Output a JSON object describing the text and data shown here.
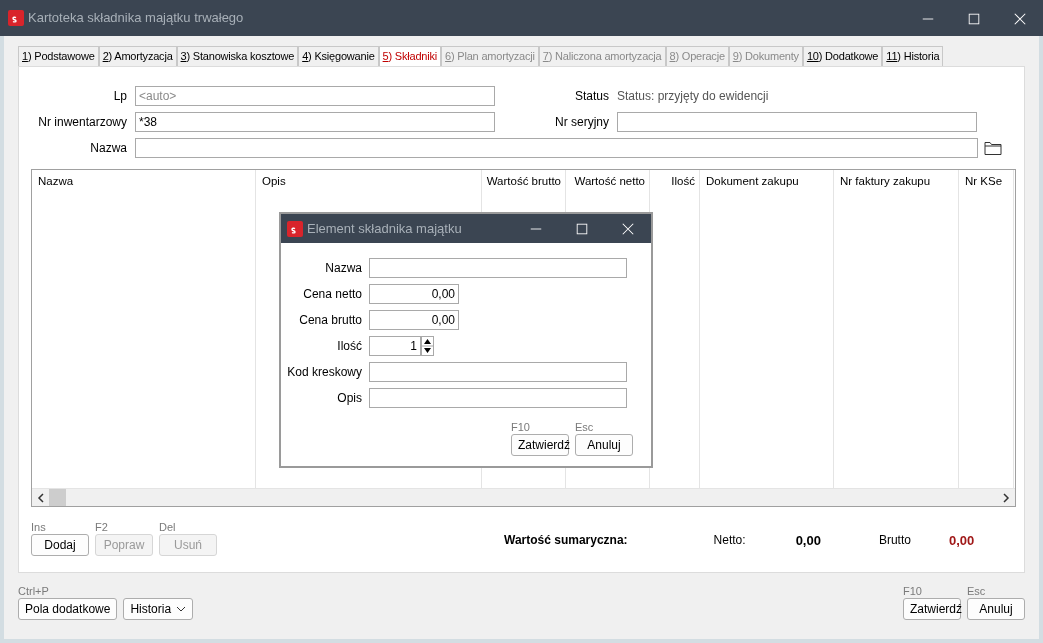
{
  "window": {
    "title": "Kartoteka składnika majątku trwałego"
  },
  "tabs": [
    {
      "key": "1",
      "label": ") Podstawowe",
      "selected": false,
      "disabled": false
    },
    {
      "key": "2",
      "label": ") Amortyzacja",
      "selected": false,
      "disabled": false
    },
    {
      "key": "3",
      "label": ") Stanowiska kosztowe",
      "selected": false,
      "disabled": false
    },
    {
      "key": "4",
      "label": ") Księgowanie",
      "selected": false,
      "disabled": false
    },
    {
      "key": "5",
      "label": ") Składniki",
      "selected": true,
      "disabled": false
    },
    {
      "key": "6",
      "label": ") Plan amortyzacji",
      "selected": false,
      "disabled": true
    },
    {
      "key": "7",
      "label": ") Naliczona amortyzacja",
      "selected": false,
      "disabled": true
    },
    {
      "key": "8",
      "label": ") Operacje",
      "selected": false,
      "disabled": true
    },
    {
      "key": "9",
      "label": ") Dokumenty",
      "selected": false,
      "disabled": true
    },
    {
      "key": "10",
      "label": ") Dodatkowe",
      "selected": false,
      "disabled": false
    },
    {
      "key": "11",
      "label": ") Historia",
      "selected": false,
      "disabled": false
    }
  ],
  "form": {
    "lp": {
      "label": "Lp",
      "placeholder": "<auto>"
    },
    "status": {
      "label": "Status",
      "value": "Status: przyjęty do ewidencji"
    },
    "inventory_no": {
      "label": "Nr inwentarzowy",
      "value": "*38"
    },
    "serial_no": {
      "label": "Nr seryjny"
    },
    "name": {
      "label": "Nazwa"
    }
  },
  "table": {
    "columns": [
      "Nazwa",
      "Opis",
      "Wartość brutto",
      "Wartość netto",
      "Ilość",
      "Dokument zakupu",
      "Nr faktury zakupu",
      "Nr KSe"
    ]
  },
  "grid_buttons": [
    {
      "shortcut": "Ins",
      "label": "Dodaj",
      "disabled": false
    },
    {
      "shortcut": "F2",
      "label": "Popraw",
      "disabled": true
    },
    {
      "shortcut": "Del",
      "label": "Usuń",
      "disabled": true
    }
  ],
  "summary": {
    "label": "Wartość sumaryczna:",
    "net_label": "Netto:",
    "net": "0,00",
    "gross_label": "Brutto",
    "gross": "0,00"
  },
  "footer": {
    "extra_shortcut": "Ctrl+P",
    "extra_button": "Pola dodatkowe",
    "history_select": "Historia",
    "ok_shortcut": "F10",
    "ok": "Zatwierdź",
    "cancel_shortcut": "Esc",
    "cancel": "Anuluj"
  },
  "dialog": {
    "title": "Element składnika majątku",
    "fields": [
      {
        "label": "Nazwa",
        "kind": "text"
      },
      {
        "label": "Cena netto",
        "kind": "number",
        "value": "0,00"
      },
      {
        "label": "Cena brutto",
        "kind": "number",
        "value": "0,00"
      },
      {
        "label": "Ilość",
        "kind": "spin",
        "value": "1"
      },
      {
        "label": "Kod kreskowy",
        "kind": "text"
      },
      {
        "label": "Opis",
        "kind": "text"
      }
    ],
    "ok_shortcut": "F10",
    "ok": "Zatwierdź",
    "cancel_shortcut": "Esc",
    "cancel": "Anuluj"
  }
}
